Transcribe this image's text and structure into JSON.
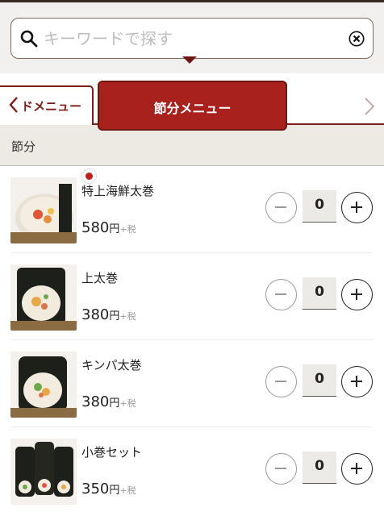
{
  "search": {
    "placeholder": "キーワードで探す"
  },
  "tabs": [
    {
      "label": "ドメニュー"
    },
    {
      "label": "節分メニュー"
    }
  ],
  "section": {
    "title": "節分"
  },
  "products": [
    {
      "name": "特上海鮮太巻",
      "price": "580",
      "unit": "円",
      "tax": "+税",
      "quantity": "0",
      "has_badge": true
    },
    {
      "name": "上太巻",
      "price": "380",
      "unit": "円",
      "tax": "+税",
      "quantity": "0"
    },
    {
      "name": "キンパ太巻",
      "price": "380",
      "unit": "円",
      "tax": "+税",
      "quantity": "0"
    },
    {
      "name": "小巻セット",
      "price": "350",
      "unit": "円",
      "tax": "+税",
      "quantity": "0"
    }
  ],
  "colors": {
    "accent": "#a8211d",
    "accent_dark": "#7b1c16",
    "section_bg": "#edeae3"
  },
  "icons": [
    "search-icon",
    "clear-icon",
    "chevron-left-icon",
    "chevron-right-icon",
    "minus-icon",
    "plus-icon"
  ]
}
